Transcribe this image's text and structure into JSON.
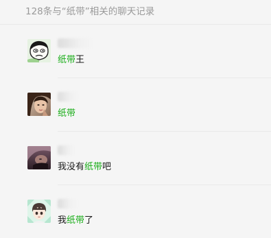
{
  "header": {
    "title": "128条与“纸带”相关的聊天记录"
  },
  "results": [
    {
      "avatar": "cartoon-face-avatar",
      "name_hidden": true,
      "message": {
        "before": "",
        "highlight": "纸带",
        "after": "王"
      }
    },
    {
      "avatar": "woman-photo-avatar",
      "name_hidden": true,
      "message": {
        "before": "",
        "highlight": "纸带",
        "after": ""
      }
    },
    {
      "avatar": "dark-photo-avatar",
      "name_hidden": true,
      "message": {
        "before": "我没有",
        "highlight": "纸带",
        "after": "吧"
      }
    },
    {
      "avatar": "anime-boy-avatar",
      "name_hidden": true,
      "message": {
        "before": "我",
        "highlight": "纸带",
        "after": "了"
      }
    }
  ],
  "colors": {
    "highlight": "#1aad19",
    "background": "#f5f5f5",
    "header_text": "#9a9a9a"
  }
}
